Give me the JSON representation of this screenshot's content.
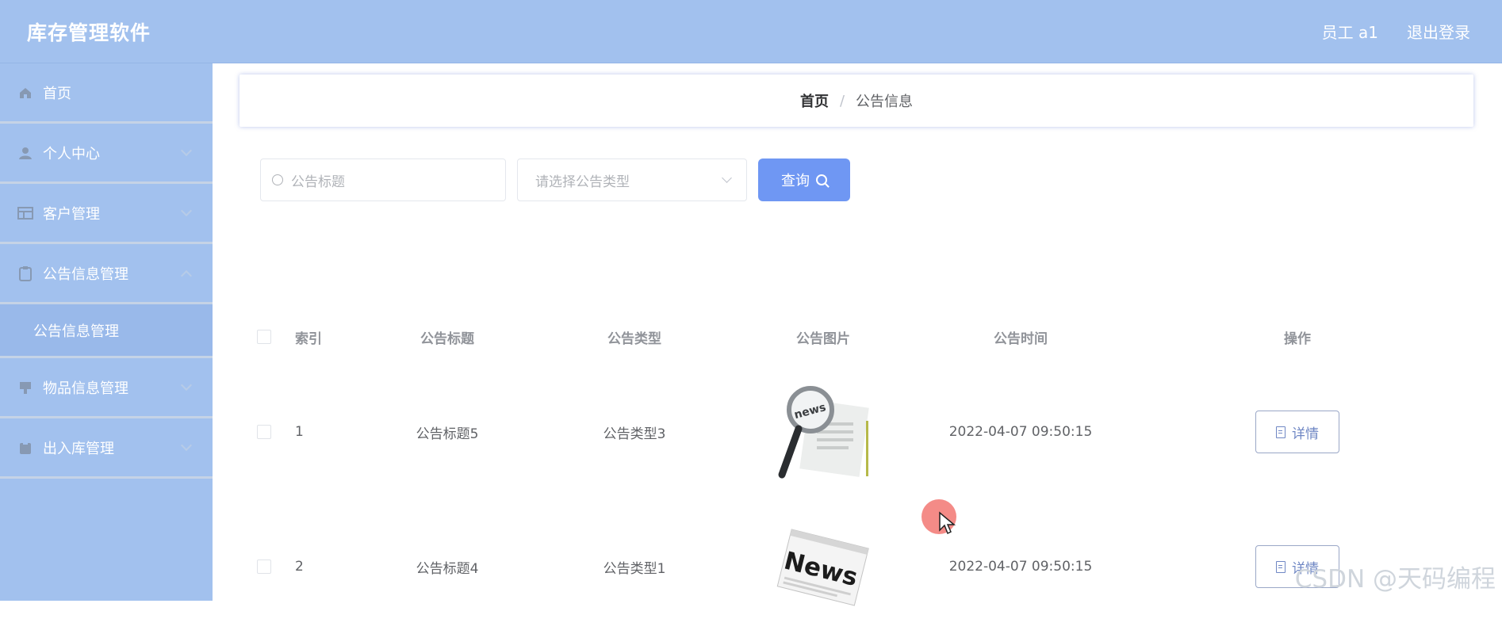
{
  "header": {
    "app_title": "库存管理软件",
    "user": "员工 a1",
    "logout": "退出登录"
  },
  "sidebar": {
    "items": [
      {
        "label": "首页",
        "icon": "home-icon"
      },
      {
        "label": "个人中心",
        "icon": "user-icon"
      },
      {
        "label": "客户管理",
        "icon": "grid-icon"
      },
      {
        "label": "公告信息管理",
        "icon": "clipboard-icon",
        "expanded": true,
        "children": [
          {
            "label": "公告信息管理"
          }
        ]
      },
      {
        "label": "物品信息管理",
        "icon": "box-icon"
      },
      {
        "label": "出入库管理",
        "icon": "storage-icon"
      }
    ]
  },
  "breadcrumb": {
    "home": "首页",
    "separator": "/",
    "current": "公告信息"
  },
  "search": {
    "title_placeholder": "公告标题",
    "type_placeholder": "请选择公告类型",
    "query_label": "查询"
  },
  "table": {
    "headers": {
      "index": "索引",
      "title": "公告标题",
      "type": "公告类型",
      "picture": "公告图片",
      "time": "公告时间",
      "op": "操作"
    },
    "rows": [
      {
        "index": "1",
        "title": "公告标题5",
        "type": "公告类型3",
        "picture": "news-magnifier-image",
        "time": "2022-04-07 09:50:15",
        "action": "详情"
      },
      {
        "index": "2",
        "title": "公告标题4",
        "type": "公告类型1",
        "picture": "news-paper-image",
        "time": "2022-04-07 09:50:15",
        "action": "详情"
      }
    ]
  },
  "watermark": "CSDN @天码编程",
  "colors": {
    "header_bg": "#a2c1ee",
    "primary_button": "#6f97f3",
    "cursor_highlight": "#f0645f"
  }
}
